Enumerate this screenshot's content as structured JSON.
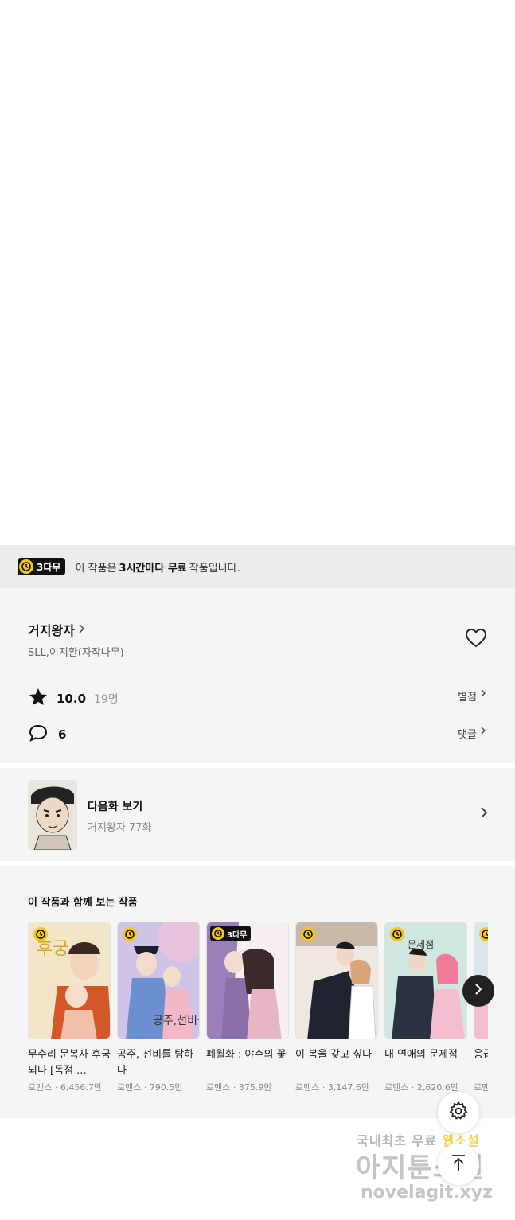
{
  "free_banner": {
    "badge": "3다무",
    "msg_prefix": "이 작품은",
    "msg_bold": "3시간마다 무료",
    "msg_suffix": "작품입니다."
  },
  "work": {
    "title": "거지왕자",
    "author": "SLL,이지환(자작나무)",
    "rating": "10.0",
    "rating_count": "19명",
    "rating_link": "별점",
    "comments": "6",
    "comment_link": "댓글"
  },
  "next_episode": {
    "label": "다음화 보기",
    "subtitle": "거지왕자 77화"
  },
  "recommendations": {
    "title": "이 작품과 함께 보는 작품",
    "items": [
      {
        "title": "무수리 문복자 후궁되다 [독점 ...",
        "genre": "로맨스",
        "views": "6,456.7만",
        "badge": "clock"
      },
      {
        "title": "공주, 선비를 탐하다",
        "genre": "로맨스",
        "views": "790.5만",
        "badge": "clock"
      },
      {
        "title": "폐월화 : 야수의 꽃",
        "genre": "로맨스",
        "views": "375.9만",
        "badge": "3다무"
      },
      {
        "title": "이 봄을 갖고 싶다",
        "genre": "로맨스",
        "views": "3,147.6만",
        "badge": "clock"
      },
      {
        "title": "내 연애의 문제점",
        "genre": "로맨스",
        "views": "2,620.6만",
        "badge": "clock"
      },
      {
        "title": "응급",
        "genre": "로맨",
        "views": "",
        "badge": "clock"
      }
    ]
  },
  "watermark": {
    "line1_a": "국내최초 무료",
    "line1_b": "웹소설",
    "line2": "아지툰소설",
    "line3": "novelagit.xyz"
  },
  "icons": {
    "settings": "gear-icon",
    "scroll_top": "arrow-up-icon",
    "favorite": "heart-icon",
    "rating": "star-icon",
    "comment": "speech-bubble-icon"
  },
  "colors": {
    "accent": "#f5c518",
    "badge_bg": "#111111",
    "panel_bg": "#f5f5f5"
  }
}
